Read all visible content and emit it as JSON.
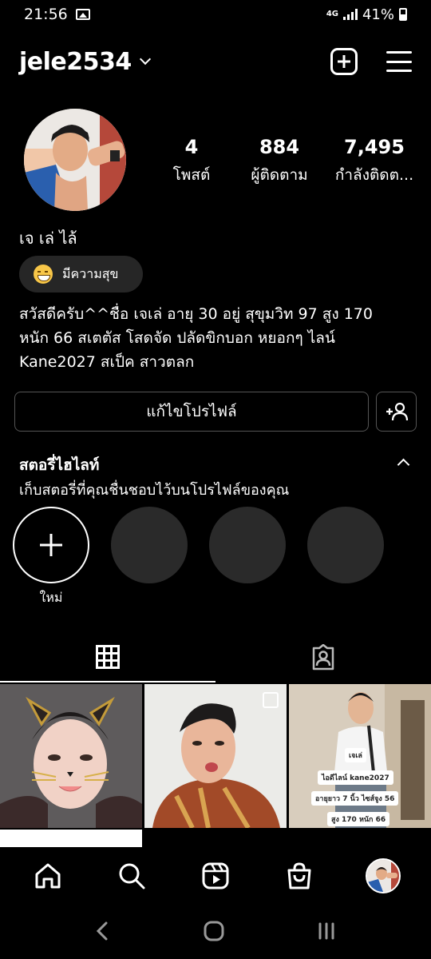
{
  "status_bar": {
    "time": "21:56",
    "network": "4G",
    "battery": "41%"
  },
  "header": {
    "username": "jele2534"
  },
  "profile": {
    "stats": [
      {
        "value": "4",
        "label": "โพสต์"
      },
      {
        "value": "884",
        "label": "ผู้ติดตาม"
      },
      {
        "value": "7,495",
        "label": "กำลังติดต..."
      }
    ],
    "full_name": "เจ เล่ ไล้",
    "mood": "มีความสุข",
    "bio_lines": [
      "สวัสดีครับ^^ชื่อ เจเล่ อายุ 30 อยู่ สุขุมวิท 97 สูง 170",
      "หนัก 66 สเตตัส โสดจัด ปลัดขิกบอก หยอกๆ ไลน์",
      "Kane2027  สเป็ค สาวตลก"
    ]
  },
  "buttons": {
    "edit_profile": "แก้ไขโปรไฟล์"
  },
  "highlights": {
    "title": "สตอรี่ไฮไลท์",
    "subtitle": "เก็บสตอรี่ที่คุณชื่นชอบไว้บนโปรไฟล์ของคุณ",
    "new_label": "ใหม่"
  },
  "photo3_text": [
    "เจเล่",
    "ไอดีไลน์ kane2027",
    "อายุยาว 7 นิ้ว ไซส์จูง 56",
    "สูง 170 หนัก 66"
  ],
  "colors": {
    "background": "#000000",
    "surface": "#262626",
    "border": "#555555",
    "text": "#ffffff"
  }
}
